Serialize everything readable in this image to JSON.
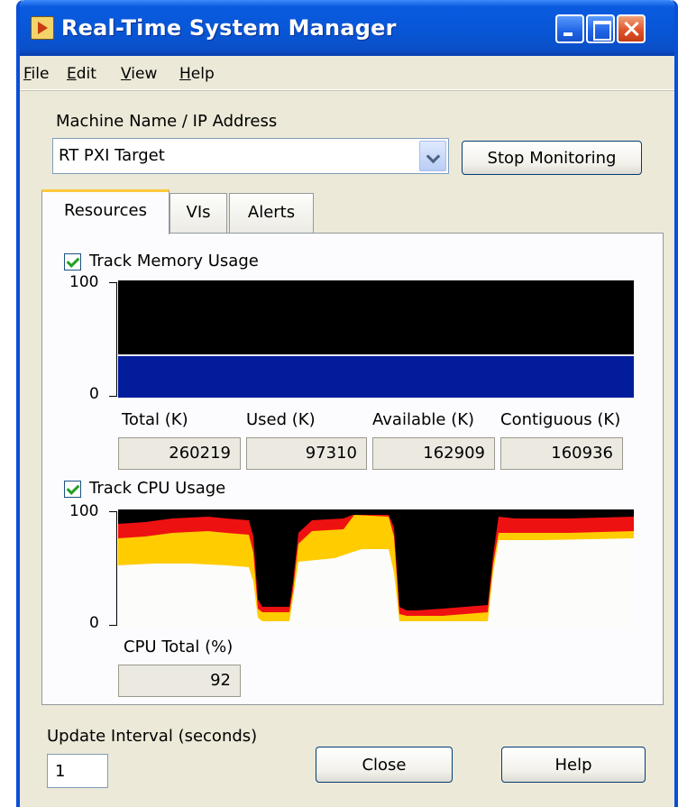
{
  "window": {
    "title": "Real-Time System Manager"
  },
  "menu": [
    {
      "accel": "F",
      "rest": "ile"
    },
    {
      "accel": "E",
      "rest": "dit"
    },
    {
      "accel": "V",
      "rest": "iew"
    },
    {
      "accel": "H",
      "rest": "elp"
    }
  ],
  "machine": {
    "label": "Machine Name / IP Address",
    "value": "RT PXI Target",
    "stop_button": "Stop Monitoring"
  },
  "tabs": [
    "Resources",
    "VIs",
    "Alerts"
  ],
  "memory": {
    "checkbox_label": "Track Memory Usage",
    "checked": true,
    "y_max": "100",
    "y_min": "0",
    "used_percent": 37,
    "headers": [
      "Total (K)",
      "Used (K)",
      "Available (K)",
      "Contiguous (K)"
    ],
    "values": [
      "260219",
      "97310",
      "162909",
      "160936"
    ]
  },
  "cpu": {
    "checkbox_label": "Track CPU Usage",
    "checked": true,
    "y_max": "100",
    "y_min": "0",
    "total_label": "CPU Total (%)",
    "total_value": "92"
  },
  "update": {
    "label": "Update Interval (seconds)",
    "value": "1"
  },
  "buttons": {
    "close": "Close",
    "help": "Help"
  },
  "colors": {
    "memory_fill": "#021c9c",
    "cpu_red": "#ee1111",
    "cpu_yellow": "#ffcc00",
    "cpu_white": "#fcfcfa",
    "chart_bg": "#000000"
  }
}
